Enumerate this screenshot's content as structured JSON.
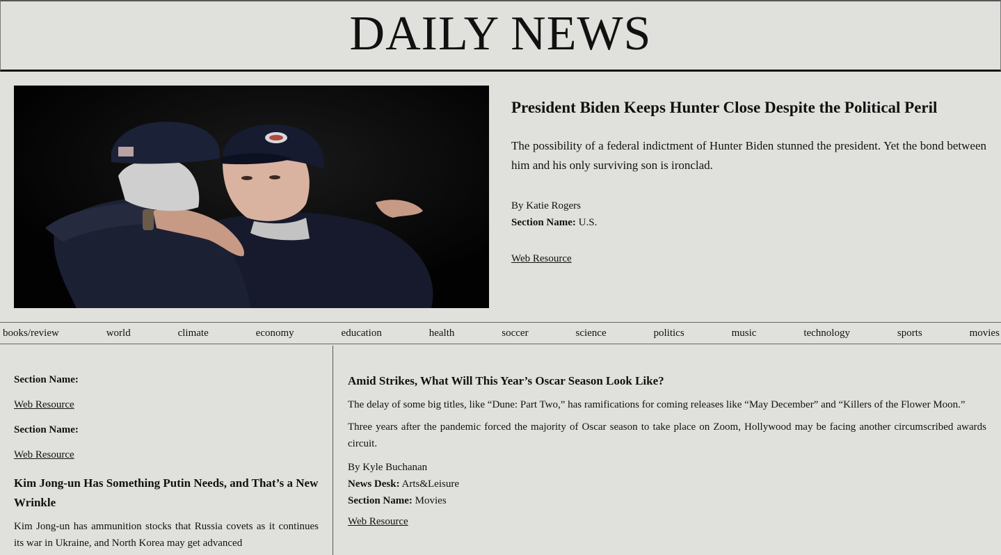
{
  "masthead": {
    "title": "DAILY NEWS"
  },
  "hero": {
    "image_alt": "Two men in caps embracing against a dark background",
    "title": "President Biden Keeps Hunter Close Despite the Political Peril",
    "abstract": "The possibility of a federal indictment of Hunter Biden stunned the president. Yet the bond between him and his only surviving son is ironclad.",
    "byline": "By Katie Rogers",
    "section_label": "Section Name:",
    "section_value": "U.S.",
    "link_label": "Web Resource"
  },
  "nav": {
    "items": [
      "books/review",
      "world",
      "climate",
      "economy",
      "education",
      "health",
      "soccer",
      "science",
      "politics",
      "music",
      "technology",
      "sports",
      "movies"
    ]
  },
  "left": {
    "blocks": [
      {
        "section_label": "Section Name:",
        "link_label": "Web Resource"
      },
      {
        "section_label": "Section Name:",
        "link_label": "Web Resource"
      }
    ],
    "article": {
      "title": "Kim Jong-un Has Something Putin Needs, and That’s a New Wrinkle",
      "abstract": "Kim Jong-un has ammunition stocks that Russia covets as it continues its war in Ukraine, and North Korea may get advanced"
    }
  },
  "right": {
    "title": "Amid Strikes, What Will This Year’s Oscar Season Look Like?",
    "p1": "The delay of some big titles, like “Dune: Part Two,” has ramifications for coming releases like “May December” and “Killers of the Flower Moon.”",
    "p2": "Three years after the pandemic forced the majority of Oscar season to take place on Zoom, Hollywood may be facing another circumscribed awards circuit.",
    "byline": "By Kyle Buchanan",
    "desk_label": "News Desk:",
    "desk_value": "Arts&Leisure",
    "section_label": "Section Name:",
    "section_value": "Movies",
    "link_label": "Web Resource"
  }
}
